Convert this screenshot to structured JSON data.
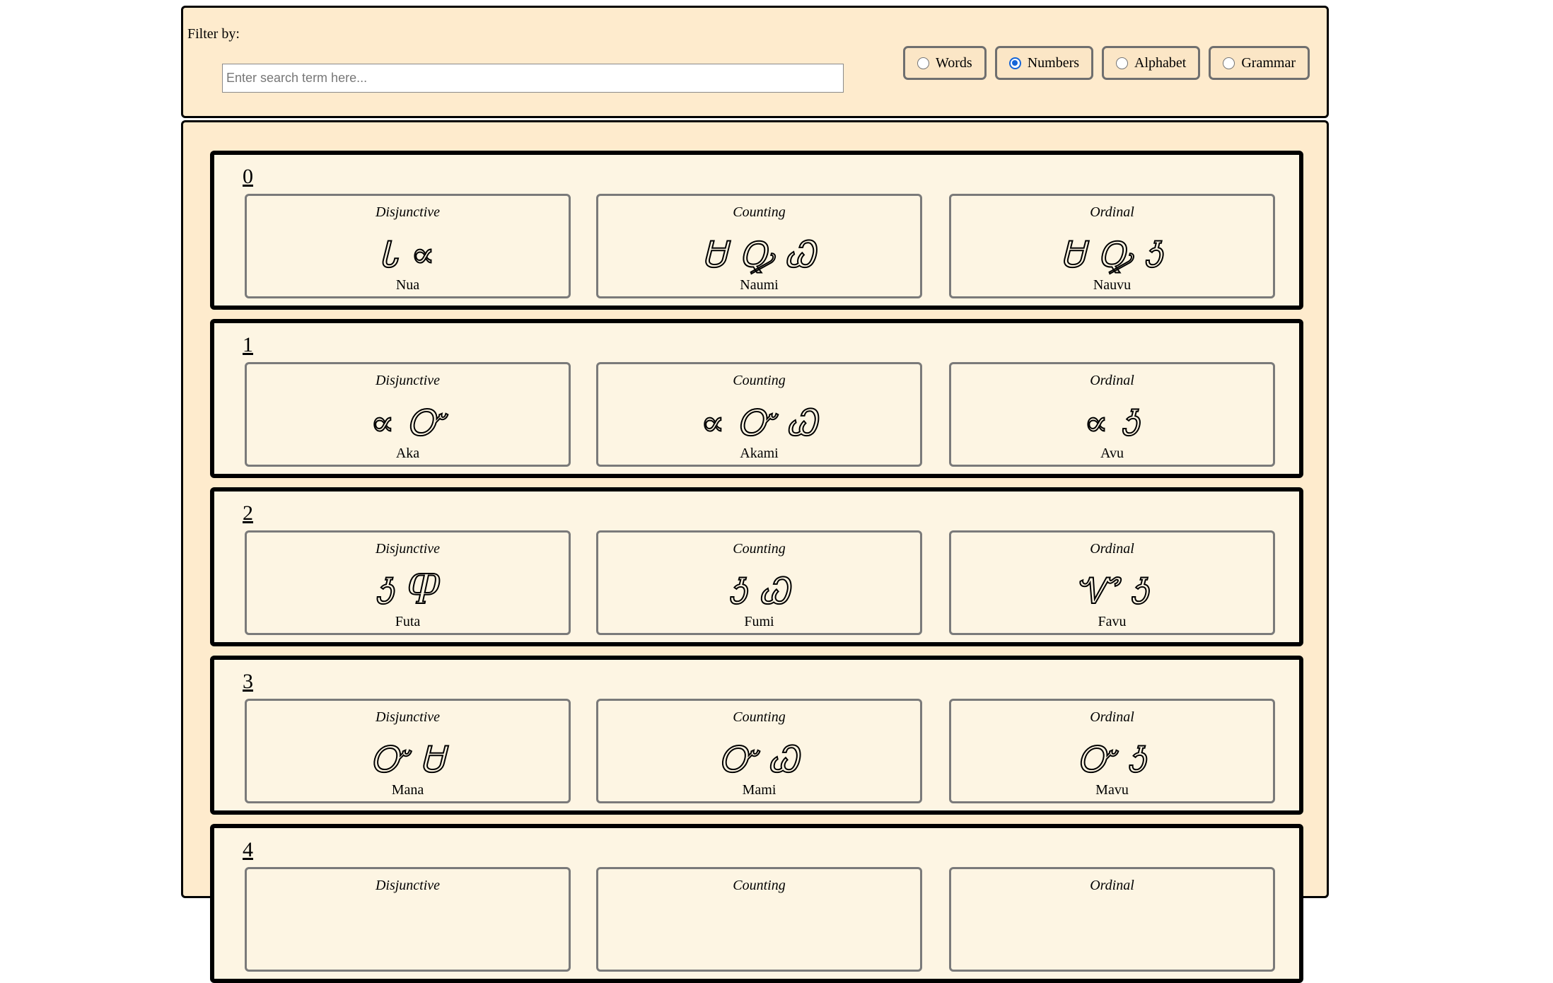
{
  "filter": {
    "label": "Filter by:",
    "search_placeholder": "Enter search term here...",
    "search_value": "",
    "options": [
      {
        "label": "Words",
        "checked": false
      },
      {
        "label": "Numbers",
        "checked": true
      },
      {
        "label": "Alphabet",
        "checked": false
      },
      {
        "label": "Grammar",
        "checked": false
      }
    ]
  },
  "numbers": [
    {
      "value": "0",
      "forms": [
        {
          "type": "Disjunctive",
          "glyphs": "Ꮣ ∝",
          "name": "Nua"
        },
        {
          "type": "Counting",
          "glyphs": "Ꮜ Ꝙ Ꮗ",
          "name": "Naumi"
        },
        {
          "type": "Ordinal",
          "glyphs": "Ꮜ Ꝙ Ꮌ",
          "name": "Nauvu"
        }
      ]
    },
    {
      "value": "1",
      "forms": [
        {
          "type": "Disjunctive",
          "glyphs": "∝ Ꮕ",
          "name": "Aka"
        },
        {
          "type": "Counting",
          "glyphs": "∝ Ꮕ Ꮗ",
          "name": "Akami"
        },
        {
          "type": "Ordinal",
          "glyphs": "∝ Ꮌ",
          "name": "Avu"
        }
      ]
    },
    {
      "value": "2",
      "forms": [
        {
          "type": "Disjunctive",
          "glyphs": "Ꮌ Ⴔ",
          "name": "Futa"
        },
        {
          "type": "Counting",
          "glyphs": "Ꮌ Ꮗ",
          "name": "Fumi"
        },
        {
          "type": "Ordinal",
          "glyphs": "Ꮙ Ꮌ",
          "name": "Favu"
        }
      ]
    },
    {
      "value": "3",
      "forms": [
        {
          "type": "Disjunctive",
          "glyphs": "Ꮕ Ꮜ",
          "name": "Mana"
        },
        {
          "type": "Counting",
          "glyphs": "Ꮕ Ꮗ",
          "name": "Mami"
        },
        {
          "type": "Ordinal",
          "glyphs": "Ꮕ Ꮌ",
          "name": "Mavu"
        }
      ]
    },
    {
      "value": "4",
      "forms": [
        {
          "type": "Disjunctive",
          "glyphs": "",
          "name": ""
        },
        {
          "type": "Counting",
          "glyphs": "",
          "name": ""
        },
        {
          "type": "Ordinal",
          "glyphs": "",
          "name": ""
        }
      ]
    }
  ]
}
